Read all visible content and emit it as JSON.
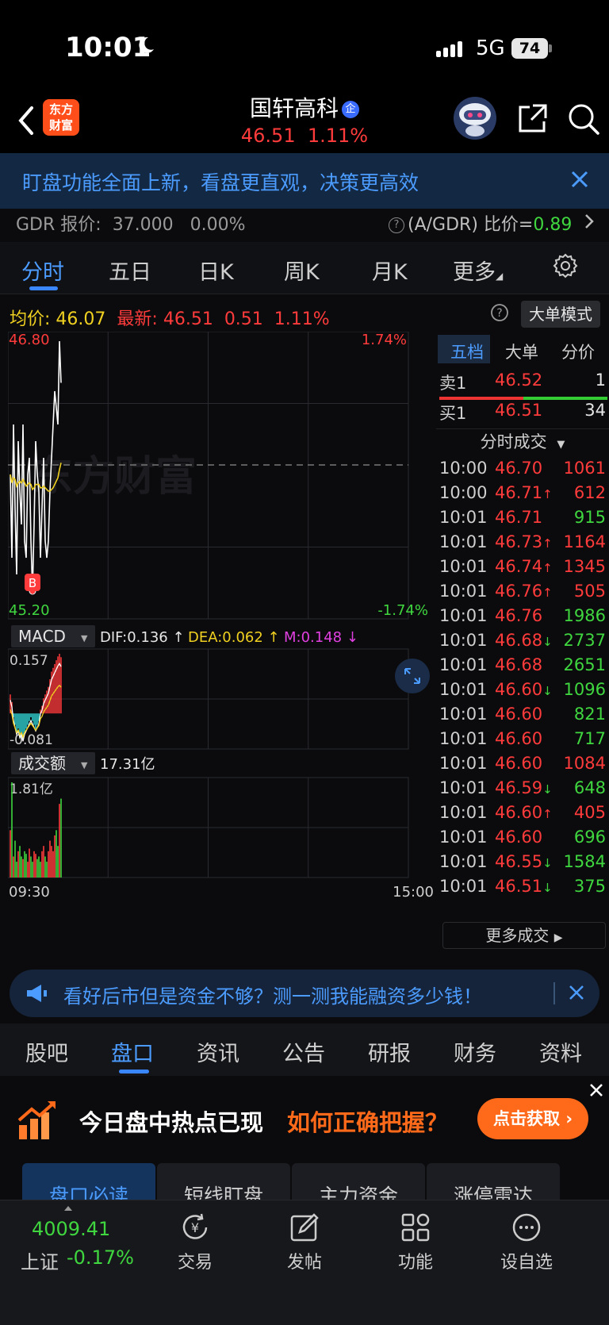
{
  "status_bar": {
    "time": "10:01",
    "network": "5G",
    "battery": "74"
  },
  "header": {
    "logo_text": "东方\n财富",
    "stock_name": "国轩高科",
    "badge": "企",
    "price": "46.51",
    "change_pct": "1.11%"
  },
  "banner": {
    "text": "盯盘功能全面上新，看盘更直观，决策更高效"
  },
  "gdr": {
    "label": "GDR 报价:",
    "price": "37.000",
    "change": "0.00%",
    "ratio_label": "(A/GDR) 比价=",
    "ratio_value": "0.89"
  },
  "period_tabs": [
    "分时",
    "五日",
    "日K",
    "周K",
    "月K",
    "更多"
  ],
  "info_line": {
    "avg_label": "均价:",
    "avg_value": "46.07",
    "latest_label": "最新:",
    "latest_price": "46.51",
    "latest_change": "0.51",
    "latest_pct": "1.11%",
    "big_order_button": "大单模式"
  },
  "chart": {
    "price_high": "46.80",
    "price_low": "45.20",
    "pct_high": "1.74%",
    "pct_low": "-1.74%",
    "watermark": "东方财富",
    "signal_marker": "B",
    "macd_selector": "MACD",
    "macd_dif": "DIF:0.136 ↑",
    "macd_dea": "DEA:0.062 ↑",
    "macd_m": "M:0.148 ↓",
    "macd_top": "0.157",
    "macd_bottom": "-0.081",
    "volume_selector": "成交额",
    "volume_total": "17.31亿",
    "volume_max": "1.81亿",
    "time_start": "09:30",
    "time_end": "15:00"
  },
  "chart_data": {
    "type": "line",
    "title": "",
    "xlabel": "",
    "ylabel": "",
    "ylim": [
      45.2,
      46.8
    ],
    "reference_price": 46.0,
    "series": [
      {
        "values": [
          46.0,
          45.5,
          46.3,
          45.8,
          45.4,
          46.2,
          45.9,
          45.7,
          46.3,
          45.6,
          45.5,
          46.0,
          46.1,
          45.6,
          45.3,
          45.7,
          46.2,
          46.0,
          45.9,
          45.5,
          45.8,
          46.1,
          45.6,
          45.5,
          45.6,
          45.9,
          46.1,
          46.3,
          46.5,
          46.4,
          46.3,
          46.8,
          46.55
        ]
      },
      {
        "values": [
          46.0,
          45.95,
          45.98,
          45.97,
          45.93,
          45.95,
          45.96,
          45.95,
          45.97,
          45.95,
          45.93,
          45.94,
          45.95,
          45.94,
          45.91,
          45.92,
          45.94,
          45.94,
          45.94,
          45.92,
          45.92,
          45.93,
          45.92,
          45.91,
          45.9,
          45.9,
          45.91,
          45.92,
          45.94,
          45.96,
          45.98,
          46.03,
          46.07
        ]
      }
    ],
    "volume": [
      0.9,
      1.81,
      0.4,
      0.7,
      0.3,
      0.5,
      0.6,
      0.4,
      0.35,
      0.5,
      0.45,
      0.3,
      0.55,
      0.4,
      0.3,
      0.5,
      0.45,
      0.35,
      0.4,
      0.3,
      0.5,
      0.6,
      0.4,
      0.3,
      0.5,
      0.7,
      0.6,
      0.5,
      0.8,
      0.9,
      0.6,
      1.4,
      1.5
    ],
    "macd": [
      0.05,
      0.03,
      -0.01,
      -0.03,
      -0.05,
      -0.04,
      -0.06,
      -0.05,
      -0.07,
      -0.05,
      -0.04,
      -0.03,
      -0.02,
      -0.01,
      -0.02,
      -0.03,
      -0.04,
      -0.03,
      -0.02,
      0.01,
      0.02,
      0.04,
      0.05,
      0.06,
      0.07,
      0.09,
      0.11,
      0.12,
      0.13,
      0.14,
      0.15,
      0.157,
      0.148
    ]
  },
  "right_panel": {
    "tabs": [
      "五档",
      "大单",
      "分价"
    ],
    "sell1_label": "卖1",
    "sell1_price": "46.52",
    "sell1_vol": "1",
    "buy1_label": "买1",
    "buy1_price": "46.51",
    "buy1_vol": "34",
    "ticks_header": "分时成交",
    "ticks": [
      {
        "time": "10:00",
        "price": "46.70",
        "arrow": "",
        "vol": "1061",
        "dir": "red"
      },
      {
        "time": "10:00",
        "price": "46.71",
        "arrow": "↑",
        "vol": "612",
        "dir": "red"
      },
      {
        "time": "10:01",
        "price": "46.71",
        "arrow": "",
        "vol": "915",
        "dir": "green"
      },
      {
        "time": "10:01",
        "price": "46.73",
        "arrow": "↑",
        "vol": "1164",
        "dir": "red"
      },
      {
        "time": "10:01",
        "price": "46.74",
        "arrow": "↑",
        "vol": "1345",
        "dir": "red"
      },
      {
        "time": "10:01",
        "price": "46.76",
        "arrow": "↑",
        "vol": "505",
        "dir": "red"
      },
      {
        "time": "10:01",
        "price": "46.76",
        "arrow": "",
        "vol": "1986",
        "dir": "green"
      },
      {
        "time": "10:01",
        "price": "46.68",
        "arrow": "↓",
        "vol": "2737",
        "dir": "green"
      },
      {
        "time": "10:01",
        "price": "46.68",
        "arrow": "",
        "vol": "2651",
        "dir": "green"
      },
      {
        "time": "10:01",
        "price": "46.60",
        "arrow": "↓",
        "vol": "1096",
        "dir": "green"
      },
      {
        "time": "10:01",
        "price": "46.60",
        "arrow": "",
        "vol": "821",
        "dir": "green"
      },
      {
        "time": "10:01",
        "price": "46.60",
        "arrow": "",
        "vol": "717",
        "dir": "green"
      },
      {
        "time": "10:01",
        "price": "46.60",
        "arrow": "",
        "vol": "1084",
        "dir": "red"
      },
      {
        "time": "10:01",
        "price": "46.59",
        "arrow": "↓",
        "vol": "648",
        "dir": "green"
      },
      {
        "time": "10:01",
        "price": "46.60",
        "arrow": "↑",
        "vol": "405",
        "dir": "red"
      },
      {
        "time": "10:01",
        "price": "46.60",
        "arrow": "",
        "vol": "696",
        "dir": "green"
      },
      {
        "time": "10:01",
        "price": "46.55",
        "arrow": "↓",
        "vol": "1584",
        "dir": "green"
      },
      {
        "time": "10:01",
        "price": "46.51",
        "arrow": "↓",
        "vol": "375",
        "dir": "green"
      }
    ],
    "more_trades": "更多成交"
  },
  "promo_financing": {
    "text": "看好后市但是资金不够？测一测我能融资多少钱！"
  },
  "content_tabs": [
    "股吧",
    "盘口",
    "资讯",
    "公告",
    "研报",
    "财务",
    "资料"
  ],
  "promo_hot": {
    "text_white": "今日盘中热点已现",
    "text_orange": "如何正确把握？",
    "button": "点击获取"
  },
  "sub_tabs": [
    "盘口必读",
    "短线盯盘",
    "主力资金",
    "涨停雷达"
  ],
  "bottom_nav": {
    "index_value": "4009.41",
    "index_name": "上证",
    "index_change": "-0.17%",
    "items": [
      "交易",
      "发帖",
      "功能",
      "设自选"
    ]
  },
  "colors": {
    "up": "#ff3b3b",
    "down": "#3fd63f",
    "accent": "#4c9cff",
    "orange": "#ff6a1a"
  }
}
